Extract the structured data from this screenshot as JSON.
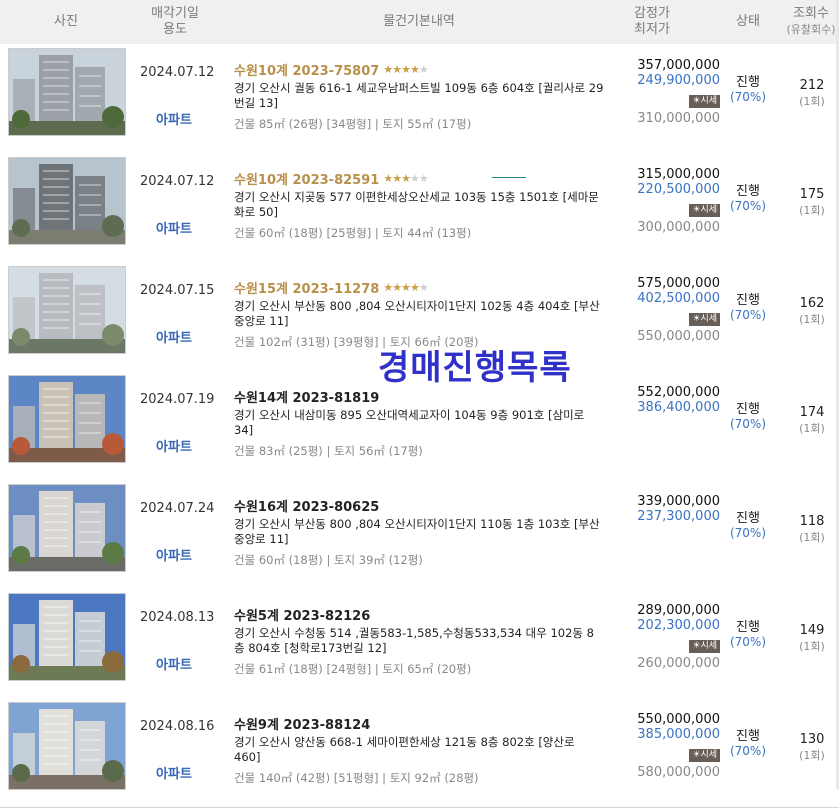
{
  "header": {
    "photo": "사진",
    "date_line1": "매각기일",
    "date_line2": "용도",
    "info": "물건기본내역",
    "price_line1": "감정가",
    "price_line2": "최저가",
    "status": "상태",
    "views_line1": "조회수",
    "views_line2": "(유찰회수)"
  },
  "watermark": "경매진행목록",
  "colors": {
    "accent_blue": "#3a72c4",
    "gold": "#b8904a",
    "watermark": "#2f31c9"
  },
  "rows": [
    {
      "date": "2024.07.12",
      "usage": "아파트",
      "case": "수원10계 2023-75807",
      "gold": true,
      "stars_on": 4,
      "addr": "경기 오산시 궐동 616-1 세교우남퍼스트빌 109동 6층 604호 [궐리사로 29번길 13]",
      "area": "건물 85㎡ (26평) [34평형]  |  토지 55㎡ (17평)",
      "appraisal": "357,000,000",
      "min": "249,900,000",
      "tag": "시세",
      "prev": "310,000,000",
      "status": "진행",
      "pct": "(70%)",
      "views": "212",
      "fails": "(1회)"
    },
    {
      "date": "2024.07.12",
      "usage": "아파트",
      "case": "수원10계 2023-82591",
      "gold": true,
      "stars_on": 3,
      "addr": "경기 오산시 지곶동 577 이편한세상오산세교 103동 15층 1501호 [세마문화로 50]",
      "area": "건물 60㎡ (18평) [25평형]  |  토지 44㎡ (13평)",
      "appraisal": "315,000,000",
      "min": "220,500,000",
      "tag": "시세",
      "prev": "300,000,000",
      "status": "진행",
      "pct": "(70%)",
      "views": "175",
      "fails": "(1회)"
    },
    {
      "date": "2024.07.15",
      "usage": "아파트",
      "case": "수원15계 2023-11278",
      "gold": true,
      "stars_on": 4,
      "addr": "경기 오산시 부산동 800 ,804 오산시티자이1단지 102동 4층 404호 [부산중앙로 11]",
      "area": "건물 102㎡ (31평) [39평형]  |  토지 66㎡ (20평)",
      "appraisal": "575,000,000",
      "min": "402,500,000",
      "tag": "시세",
      "prev": "550,000,000",
      "status": "진행",
      "pct": "(70%)",
      "views": "162",
      "fails": "(1회)"
    },
    {
      "date": "2024.07.19",
      "usage": "아파트",
      "case": "수원14계 2023-81819",
      "gold": false,
      "stars_on": 0,
      "addr": "경기 오산시 내삼미동 895 오산대역세교자이 104동 9층 901호 [삼미로 34]",
      "area": "건물 83㎡ (25평)  |  토지 56㎡ (17평)",
      "appraisal": "552,000,000",
      "min": "386,400,000",
      "tag": "",
      "prev": "",
      "status": "진행",
      "pct": "(70%)",
      "views": "174",
      "fails": "(1회)"
    },
    {
      "date": "2024.07.24",
      "usage": "아파트",
      "case": "수원16계 2023-80625",
      "gold": false,
      "stars_on": 0,
      "addr": "경기 오산시 부산동 800 ,804 오산시티자이1단지 110동 1층 103호 [부산중앙로 11]",
      "area": "건물 60㎡ (18평)  |  토지 39㎡ (12평)",
      "appraisal": "339,000,000",
      "min": "237,300,000",
      "tag": "",
      "prev": "",
      "status": "진행",
      "pct": "(70%)",
      "views": "118",
      "fails": "(1회)"
    },
    {
      "date": "2024.08.13",
      "usage": "아파트",
      "case": "수원5계 2023-82126",
      "gold": false,
      "stars_on": 0,
      "addr": "경기 오산시 수청동 514 ,궐동583-1,585,수청동533,534 대우 102동 8층 804호 [청학로173번길 12]",
      "area": "건물 61㎡ (18평) [24평형]  |  토지 65㎡ (20평)",
      "appraisal": "289,000,000",
      "min": "202,300,000",
      "tag": "시세",
      "prev": "260,000,000",
      "status": "진행",
      "pct": "(70%)",
      "views": "149",
      "fails": "(1회)"
    },
    {
      "date": "2024.08.16",
      "usage": "아파트",
      "case": "수원9계 2023-88124",
      "gold": false,
      "stars_on": 0,
      "addr": "경기 오산시 양산동 668-1 세마이편한세상 121동 8층 802호 [양산로 460]",
      "area": "건물 140㎡ (42평) [51평형]  |  토지 92㎡ (28평)",
      "appraisal": "550,000,000",
      "min": "385,000,000",
      "tag": "시세",
      "prev": "580,000,000",
      "status": "진행",
      "pct": "(70%)",
      "views": "130",
      "fails": "(1회)"
    }
  ]
}
